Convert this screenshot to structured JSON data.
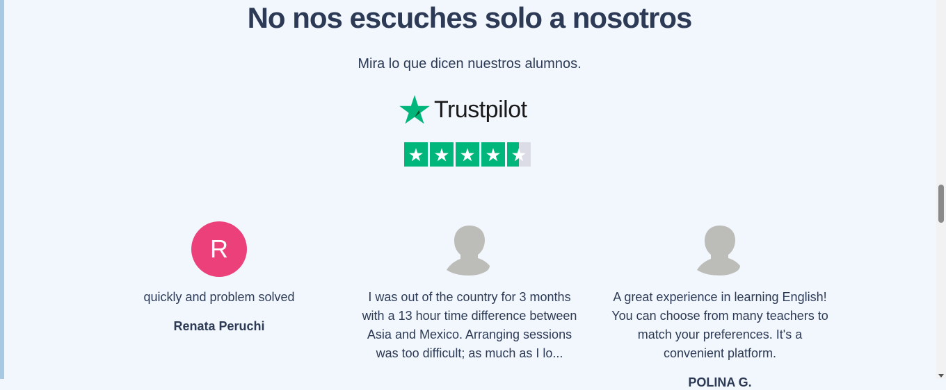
{
  "section": {
    "title": "No nos escuches solo a nosotros",
    "subtitle": "Mira lo que dicen nuestros alumnos."
  },
  "trustpilot": {
    "brand": "Trustpilot",
    "rating_stars": 4.5,
    "star_color": "#00b67a"
  },
  "reviews": [
    {
      "avatar_letter": "R",
      "avatar_color": "#ec407a",
      "text": "quickly and problem solved",
      "author": "Renata Peruchi"
    },
    {
      "avatar_icon": "generic-avatar-icon",
      "text": "I was out of the country for 3 months with a 13 hour time difference between Asia and Mexico. Arranging sessions was too difficult; as much as I lo...",
      "author": ""
    },
    {
      "avatar_icon": "generic-avatar-icon",
      "text": "A great experience in learning English! You can choose from many teachers to match your preferences. It's a convenient platform.",
      "author": "POLINA G."
    }
  ]
}
